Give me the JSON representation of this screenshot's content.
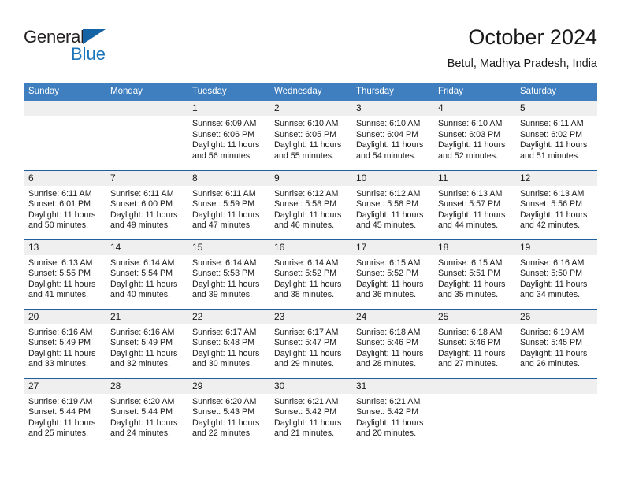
{
  "logo": {
    "word_top": "General",
    "word_bottom": "Blue",
    "triangle_color": "#1464a5",
    "blue_color": "#1b75bb"
  },
  "header": {
    "title": "October 2024",
    "subtitle": "Betul, Madhya Pradesh, India"
  },
  "theme": {
    "header_bg": "#3f7fbf",
    "rule_color": "#205f9e",
    "daynum_bg": "#efefef",
    "text_color": "#1a1a1a"
  },
  "weekday_headers": [
    "Sunday",
    "Monday",
    "Tuesday",
    "Wednesday",
    "Thursday",
    "Friday",
    "Saturday"
  ],
  "weeks": [
    [
      {
        "day": "",
        "sunrise": "",
        "sunset": "",
        "daylight_line1": "",
        "daylight_line2": ""
      },
      {
        "day": "",
        "sunrise": "",
        "sunset": "",
        "daylight_line1": "",
        "daylight_line2": ""
      },
      {
        "day": "1",
        "sunrise": "Sunrise: 6:09 AM",
        "sunset": "Sunset: 6:06 PM",
        "daylight_line1": "Daylight: 11 hours",
        "daylight_line2": "and 56 minutes."
      },
      {
        "day": "2",
        "sunrise": "Sunrise: 6:10 AM",
        "sunset": "Sunset: 6:05 PM",
        "daylight_line1": "Daylight: 11 hours",
        "daylight_line2": "and 55 minutes."
      },
      {
        "day": "3",
        "sunrise": "Sunrise: 6:10 AM",
        "sunset": "Sunset: 6:04 PM",
        "daylight_line1": "Daylight: 11 hours",
        "daylight_line2": "and 54 minutes."
      },
      {
        "day": "4",
        "sunrise": "Sunrise: 6:10 AM",
        "sunset": "Sunset: 6:03 PM",
        "daylight_line1": "Daylight: 11 hours",
        "daylight_line2": "and 52 minutes."
      },
      {
        "day": "5",
        "sunrise": "Sunrise: 6:11 AM",
        "sunset": "Sunset: 6:02 PM",
        "daylight_line1": "Daylight: 11 hours",
        "daylight_line2": "and 51 minutes."
      }
    ],
    [
      {
        "day": "6",
        "sunrise": "Sunrise: 6:11 AM",
        "sunset": "Sunset: 6:01 PM",
        "daylight_line1": "Daylight: 11 hours",
        "daylight_line2": "and 50 minutes."
      },
      {
        "day": "7",
        "sunrise": "Sunrise: 6:11 AM",
        "sunset": "Sunset: 6:00 PM",
        "daylight_line1": "Daylight: 11 hours",
        "daylight_line2": "and 49 minutes."
      },
      {
        "day": "8",
        "sunrise": "Sunrise: 6:11 AM",
        "sunset": "Sunset: 5:59 PM",
        "daylight_line1": "Daylight: 11 hours",
        "daylight_line2": "and 47 minutes."
      },
      {
        "day": "9",
        "sunrise": "Sunrise: 6:12 AM",
        "sunset": "Sunset: 5:58 PM",
        "daylight_line1": "Daylight: 11 hours",
        "daylight_line2": "and 46 minutes."
      },
      {
        "day": "10",
        "sunrise": "Sunrise: 6:12 AM",
        "sunset": "Sunset: 5:58 PM",
        "daylight_line1": "Daylight: 11 hours",
        "daylight_line2": "and 45 minutes."
      },
      {
        "day": "11",
        "sunrise": "Sunrise: 6:13 AM",
        "sunset": "Sunset: 5:57 PM",
        "daylight_line1": "Daylight: 11 hours",
        "daylight_line2": "and 44 minutes."
      },
      {
        "day": "12",
        "sunrise": "Sunrise: 6:13 AM",
        "sunset": "Sunset: 5:56 PM",
        "daylight_line1": "Daylight: 11 hours",
        "daylight_line2": "and 42 minutes."
      }
    ],
    [
      {
        "day": "13",
        "sunrise": "Sunrise: 6:13 AM",
        "sunset": "Sunset: 5:55 PM",
        "daylight_line1": "Daylight: 11 hours",
        "daylight_line2": "and 41 minutes."
      },
      {
        "day": "14",
        "sunrise": "Sunrise: 6:14 AM",
        "sunset": "Sunset: 5:54 PM",
        "daylight_line1": "Daylight: 11 hours",
        "daylight_line2": "and 40 minutes."
      },
      {
        "day": "15",
        "sunrise": "Sunrise: 6:14 AM",
        "sunset": "Sunset: 5:53 PM",
        "daylight_line1": "Daylight: 11 hours",
        "daylight_line2": "and 39 minutes."
      },
      {
        "day": "16",
        "sunrise": "Sunrise: 6:14 AM",
        "sunset": "Sunset: 5:52 PM",
        "daylight_line1": "Daylight: 11 hours",
        "daylight_line2": "and 38 minutes."
      },
      {
        "day": "17",
        "sunrise": "Sunrise: 6:15 AM",
        "sunset": "Sunset: 5:52 PM",
        "daylight_line1": "Daylight: 11 hours",
        "daylight_line2": "and 36 minutes."
      },
      {
        "day": "18",
        "sunrise": "Sunrise: 6:15 AM",
        "sunset": "Sunset: 5:51 PM",
        "daylight_line1": "Daylight: 11 hours",
        "daylight_line2": "and 35 minutes."
      },
      {
        "day": "19",
        "sunrise": "Sunrise: 6:16 AM",
        "sunset": "Sunset: 5:50 PM",
        "daylight_line1": "Daylight: 11 hours",
        "daylight_line2": "and 34 minutes."
      }
    ],
    [
      {
        "day": "20",
        "sunrise": "Sunrise: 6:16 AM",
        "sunset": "Sunset: 5:49 PM",
        "daylight_line1": "Daylight: 11 hours",
        "daylight_line2": "and 33 minutes."
      },
      {
        "day": "21",
        "sunrise": "Sunrise: 6:16 AM",
        "sunset": "Sunset: 5:49 PM",
        "daylight_line1": "Daylight: 11 hours",
        "daylight_line2": "and 32 minutes."
      },
      {
        "day": "22",
        "sunrise": "Sunrise: 6:17 AM",
        "sunset": "Sunset: 5:48 PM",
        "daylight_line1": "Daylight: 11 hours",
        "daylight_line2": "and 30 minutes."
      },
      {
        "day": "23",
        "sunrise": "Sunrise: 6:17 AM",
        "sunset": "Sunset: 5:47 PM",
        "daylight_line1": "Daylight: 11 hours",
        "daylight_line2": "and 29 minutes."
      },
      {
        "day": "24",
        "sunrise": "Sunrise: 6:18 AM",
        "sunset": "Sunset: 5:46 PM",
        "daylight_line1": "Daylight: 11 hours",
        "daylight_line2": "and 28 minutes."
      },
      {
        "day": "25",
        "sunrise": "Sunrise: 6:18 AM",
        "sunset": "Sunset: 5:46 PM",
        "daylight_line1": "Daylight: 11 hours",
        "daylight_line2": "and 27 minutes."
      },
      {
        "day": "26",
        "sunrise": "Sunrise: 6:19 AM",
        "sunset": "Sunset: 5:45 PM",
        "daylight_line1": "Daylight: 11 hours",
        "daylight_line2": "and 26 minutes."
      }
    ],
    [
      {
        "day": "27",
        "sunrise": "Sunrise: 6:19 AM",
        "sunset": "Sunset: 5:44 PM",
        "daylight_line1": "Daylight: 11 hours",
        "daylight_line2": "and 25 minutes."
      },
      {
        "day": "28",
        "sunrise": "Sunrise: 6:20 AM",
        "sunset": "Sunset: 5:44 PM",
        "daylight_line1": "Daylight: 11 hours",
        "daylight_line2": "and 24 minutes."
      },
      {
        "day": "29",
        "sunrise": "Sunrise: 6:20 AM",
        "sunset": "Sunset: 5:43 PM",
        "daylight_line1": "Daylight: 11 hours",
        "daylight_line2": "and 22 minutes."
      },
      {
        "day": "30",
        "sunrise": "Sunrise: 6:21 AM",
        "sunset": "Sunset: 5:42 PM",
        "daylight_line1": "Daylight: 11 hours",
        "daylight_line2": "and 21 minutes."
      },
      {
        "day": "31",
        "sunrise": "Sunrise: 6:21 AM",
        "sunset": "Sunset: 5:42 PM",
        "daylight_line1": "Daylight: 11 hours",
        "daylight_line2": "and 20 minutes."
      },
      {
        "day": "",
        "sunrise": "",
        "sunset": "",
        "daylight_line1": "",
        "daylight_line2": ""
      },
      {
        "day": "",
        "sunrise": "",
        "sunset": "",
        "daylight_line1": "",
        "daylight_line2": ""
      }
    ]
  ]
}
